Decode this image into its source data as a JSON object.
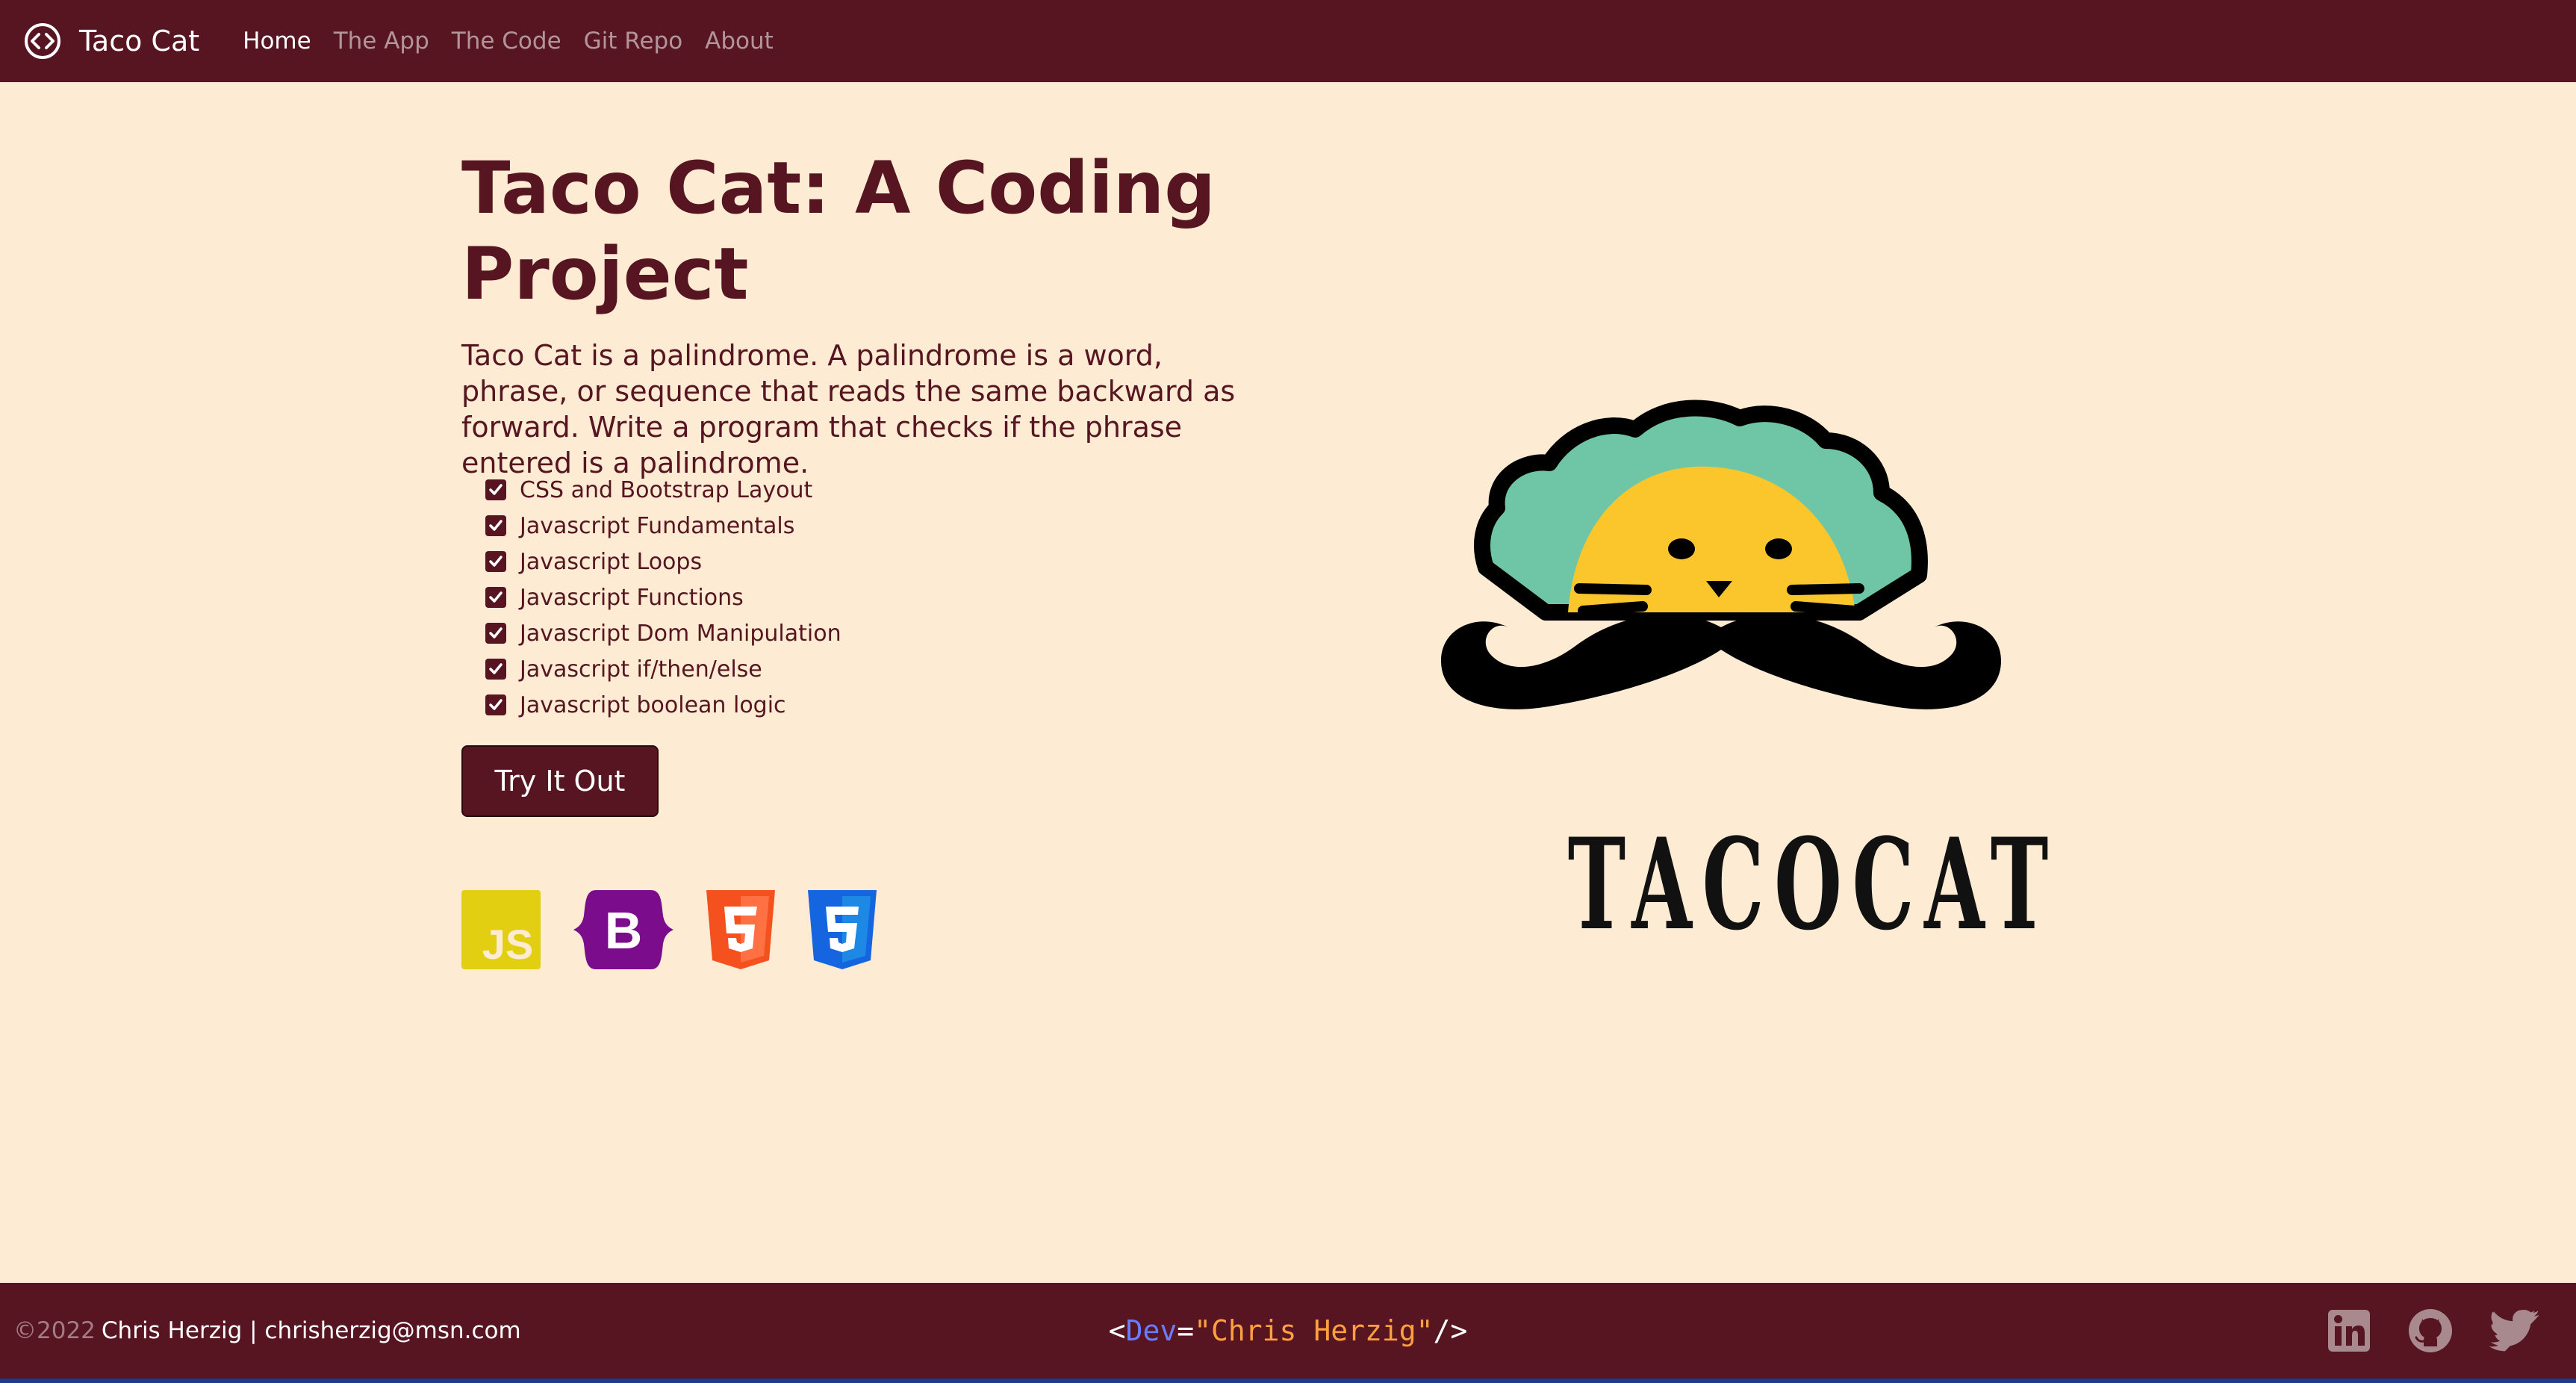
{
  "nav": {
    "brand": "Taco Cat",
    "links": [
      {
        "label": "Home",
        "active": true
      },
      {
        "label": "The App",
        "active": false
      },
      {
        "label": "The Code",
        "active": false
      },
      {
        "label": "Git Repo",
        "active": false
      },
      {
        "label": "About",
        "active": false
      }
    ]
  },
  "hero": {
    "title": "Taco Cat: A Coding Project",
    "description": "Taco Cat is a palindrome. A palindrome is a word, phrase, or sequence that reads the same backward as forward. Write a program that checks if the phrase entered is a palindrome.",
    "features": [
      "CSS and Bootstrap Layout",
      "Javascript Fundamentals",
      "Javascript Loops",
      "Javascript Functions",
      "Javascript Dom Manipulation",
      "Javascript if/then/else",
      "Javascript boolean logic"
    ],
    "button_label": "Try It Out",
    "tech_icons": [
      {
        "name": "javascript-icon",
        "text": "JS"
      },
      {
        "name": "bootstrap-icon",
        "text": "B"
      },
      {
        "name": "html5-icon",
        "text": "5"
      },
      {
        "name": "css3-icon",
        "text": "3"
      }
    ]
  },
  "logo": {
    "text": "TACOCAT"
  },
  "footer": {
    "year": "©2022",
    "author": "Chris Herzig | chrisherzig@msn.com",
    "code": {
      "open": "<",
      "tag": "Dev",
      "eq": "=",
      "value": "\"Chris Herzig\"",
      "close": "/>"
    },
    "social": [
      "linkedin-icon",
      "github-icon",
      "twitter-icon"
    ]
  },
  "colors": {
    "primary": "#561521",
    "background": "#fdebd3",
    "javascript": "#e3cf12",
    "bootstrap": "#7b0c8b",
    "html5": "#f4511e",
    "css3": "#1565e0"
  }
}
